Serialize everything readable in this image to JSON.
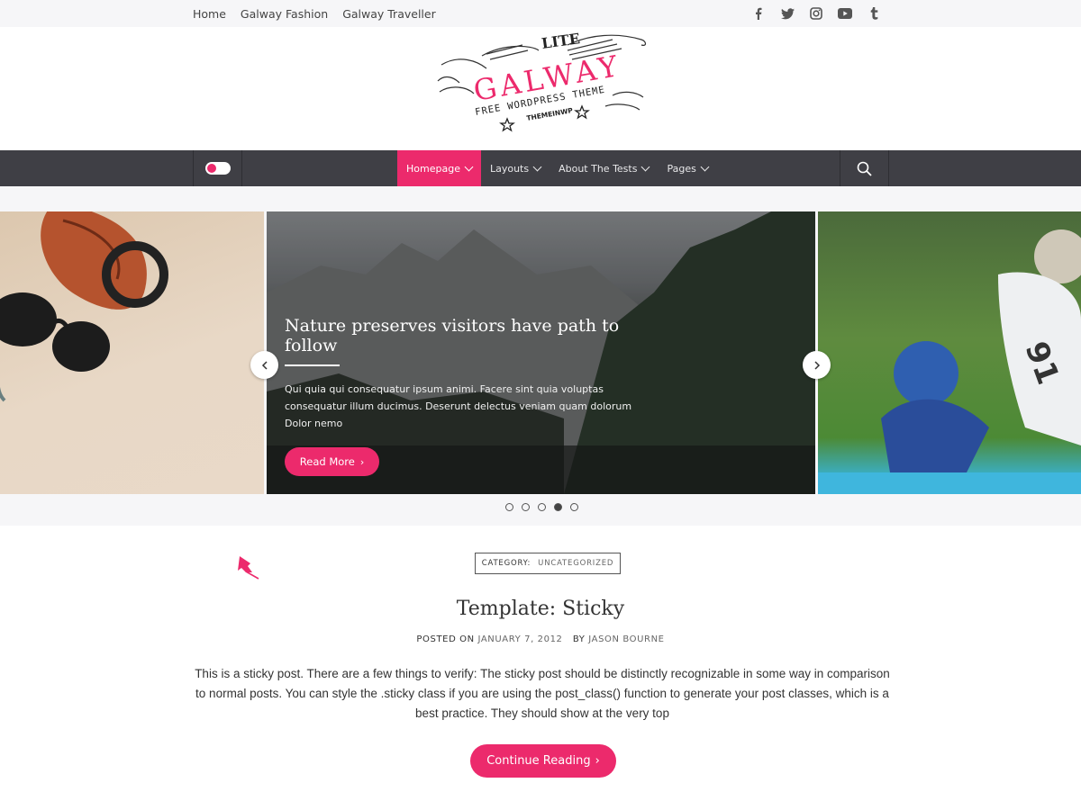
{
  "colors": {
    "accent": "#ec2a6c",
    "nav_bg": "#3f3f45",
    "topbar_bg": "#f6f6f8"
  },
  "topbar": {
    "links": [
      "Home",
      "Galway Fashion",
      "Galway Traveller"
    ],
    "social_icons": [
      "facebook-icon",
      "twitter-icon",
      "instagram-icon",
      "youtube-icon",
      "tumblr-icon"
    ]
  },
  "logo": {
    "badge": "LITE",
    "name": "GALWAY",
    "tagline": "FREE WORDPRESS THEME",
    "credit": "THEMEINWP"
  },
  "nav": {
    "items": [
      {
        "label": "Homepage",
        "active": true
      },
      {
        "label": "Layouts"
      },
      {
        "label": "About The Tests"
      },
      {
        "label": "Pages"
      }
    ]
  },
  "slider": {
    "title": "Nature preserves visitors have path to follow",
    "excerpt": "Qui quia qui consequatur ipsum animi. Facere sint quia voluptas consequatur illum ducimus. Deserunt delectus veniam quam dolorum Dolor nemo",
    "button": "Read More",
    "slide_count": 5,
    "active_slide_number": 4
  },
  "post": {
    "category_label": "CATEGORY:",
    "category_value": "UNCATEGORIZED",
    "title": "Template: Sticky",
    "posted_on_label": "POSTED ON",
    "date": "JANUARY 7, 2012",
    "by_label": "BY",
    "author": "JASON BOURNE",
    "excerpt": "This is a sticky post. There are a few things to verify: The sticky post should be distinctly recognizable in some way in comparison to normal posts. You can style the .sticky class if you are using the post_class() function to generate your post classes, which is a best practice. They should show at the very top",
    "button": "Continue Reading"
  }
}
